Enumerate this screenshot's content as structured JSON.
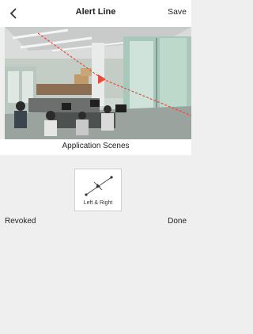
{
  "header": {
    "back_icon": "chevron-left-icon",
    "title": "Alert Line",
    "save_label": "Save"
  },
  "camera": {
    "description_icon": "camera-feed"
  },
  "scenes": {
    "label": "Application Scenes",
    "items": [
      {
        "label": "Left & Right",
        "icon": "direction-line-icon",
        "selected": true
      }
    ]
  },
  "actions": {
    "revoked_label": "Revoked",
    "done_label": "Done"
  },
  "colors": {
    "accent_line": "#e84b3c",
    "background": "#efefef",
    "header_bg": "#ffffff"
  }
}
